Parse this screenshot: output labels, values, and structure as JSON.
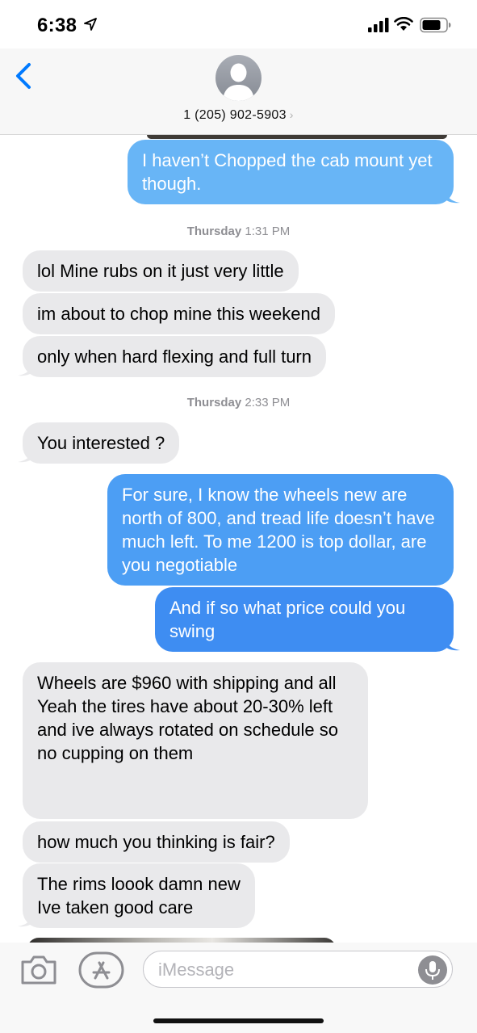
{
  "status_bar": {
    "time": "6:38"
  },
  "header": {
    "contact": "1 (205) 902-5903",
    "chevron": "›"
  },
  "messages": [
    {
      "dir": "out",
      "text": "I haven’t Chopped the cab mount yet though."
    },
    {
      "dir": "ts",
      "day": "Thursday",
      "time": "1:31 PM"
    },
    {
      "dir": "in",
      "text": "lol Mine rubs on it just very little"
    },
    {
      "dir": "in",
      "text": "im about to chop mine this weekend"
    },
    {
      "dir": "in",
      "text": "only when hard flexing and full turn"
    },
    {
      "dir": "ts",
      "day": "Thursday",
      "time": "2:33 PM"
    },
    {
      "dir": "in",
      "text": "You interested ?"
    },
    {
      "dir": "out",
      "text": "For sure, I know the wheels new are north of 800, and tread life doesn’t have much left. To me 1200 is top dollar, are you negotiable"
    },
    {
      "dir": "out",
      "text": "And if so what price could you swing"
    },
    {
      "dir": "in",
      "text": "Wheels are $960 with shipping and all\nYeah the tires have about 20-30% left and ive always rotated on schedule so no cupping on them"
    },
    {
      "dir": "in",
      "text": "how much you thinking is fair?"
    },
    {
      "dir": "in",
      "text": "The rims loook damn new\nIve taken good care"
    }
  ],
  "input": {
    "placeholder": "iMessage"
  },
  "colors": {
    "incoming": "#e9e9eb",
    "outgoing": "#4c9ef4",
    "link": "#007aff"
  },
  "icons": [
    "location-arrow-icon",
    "signal-icon",
    "wifi-icon",
    "battery-icon",
    "back-chevron-icon",
    "contact-avatar-icon",
    "camera-icon",
    "app-store-icon",
    "microphone-icon"
  ]
}
